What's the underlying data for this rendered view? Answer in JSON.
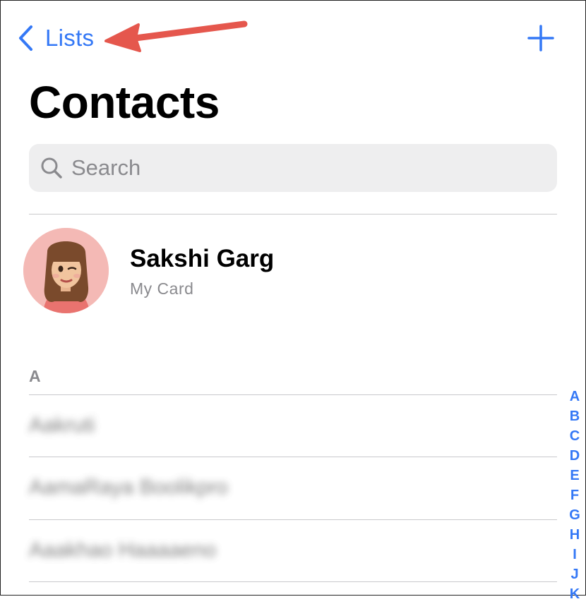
{
  "nav": {
    "back_label": "Lists",
    "back_icon": "chevron-left-icon",
    "add_icon": "plus-icon"
  },
  "colors": {
    "accent": "#3478f6",
    "annotation": "#e5574d",
    "secondary_text": "#8a8a8e",
    "search_bg": "#eeeeef"
  },
  "title": "Contacts",
  "search": {
    "placeholder": "Search",
    "icon": "magnifier-icon"
  },
  "my_card": {
    "name": "Sakshi Garg",
    "subtitle": "My Card"
  },
  "sections": [
    {
      "header": "A",
      "contacts": [
        {
          "name": "Aakruti"
        },
        {
          "name": "AamaRaya Boolikpro"
        },
        {
          "name": "Aaakhao Haaaaeno"
        }
      ]
    }
  ],
  "index_letters": [
    "A",
    "B",
    "C",
    "D",
    "E",
    "F",
    "G",
    "H",
    "I",
    "J",
    "K"
  ]
}
